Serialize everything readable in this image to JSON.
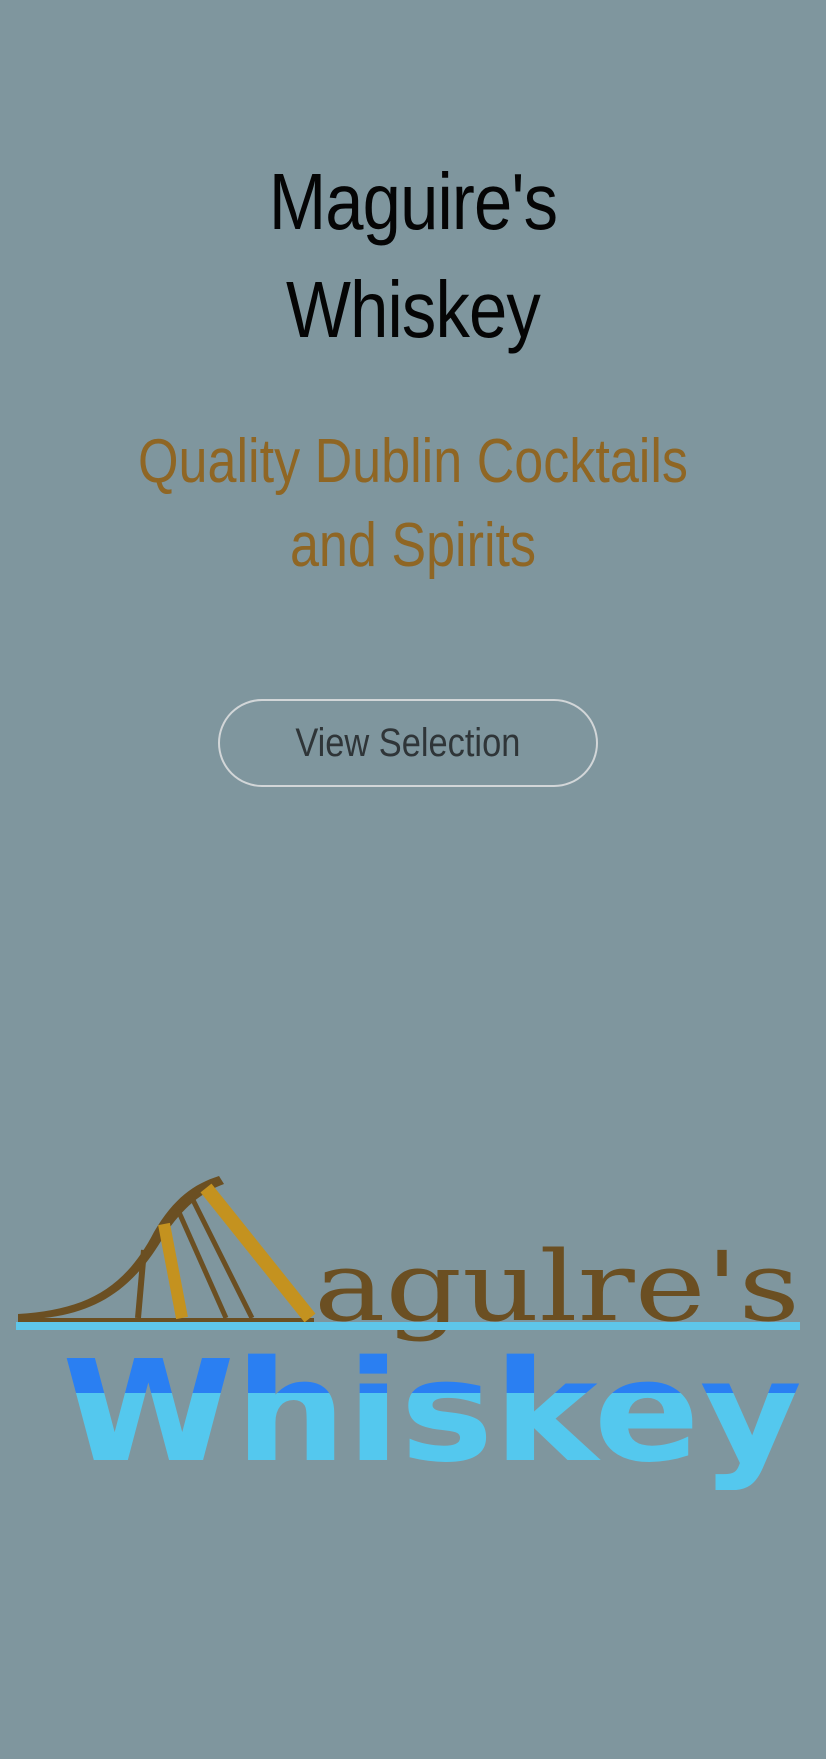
{
  "hero": {
    "title_line1": "Maguire's",
    "title_line2": "Whiskey",
    "subtitle": "Quality Dublin Cocktails and Spirits",
    "cta_label": "View Selection"
  },
  "logo": {
    "top_word": "agulre's",
    "bottom_word": "Whiskey",
    "colors": {
      "brown": "#6b4f22",
      "gold": "#c4921f",
      "blue_dark": "#2a7ff2",
      "blue_light": "#54c8ee",
      "line": "#5ec6ea"
    }
  },
  "colors": {
    "background": "#7f969e",
    "title": "#050505",
    "subtitle": "#8f6624",
    "button_border": "#d2d6d8",
    "button_text": "#2f3538"
  }
}
